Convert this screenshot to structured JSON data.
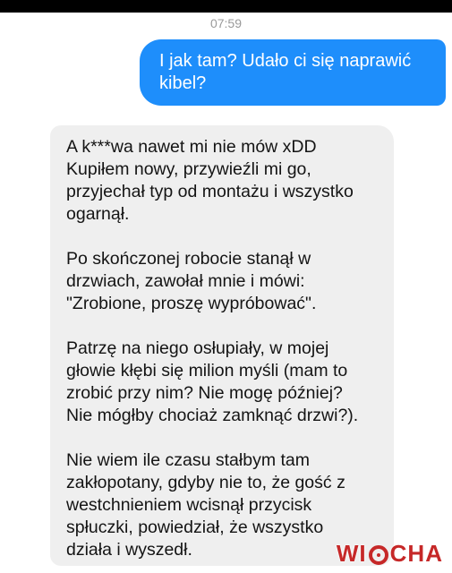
{
  "status": {
    "time": "07:59"
  },
  "messages": {
    "outgoing": {
      "lines": [
        "I jak tam? Udało ci się naprawić",
        "kibel?"
      ]
    },
    "incoming": {
      "paragraphs": [
        [
          "A k***wa nawet mi nie mów xDD",
          "Kupiłem nowy, przywieźli mi go,",
          "przyjechał typ od montażu i wszystko",
          "ogarnął."
        ],
        [
          "Po skończonej robocie stanął w",
          "drzwiach, zawołał mnie i mówi:",
          "\"Zrobione, proszę wypróbować\"."
        ],
        [
          "Patrzę na niego osłupiały, w mojej",
          "głowie kłębi się milion myśli (mam to",
          "zrobić przy nim? Nie mogę później?",
          "Nie mógłby chociaż zamknąć drzwi?)."
        ],
        [
          "Nie wiem ile czasu stałbym tam",
          "zakłopotany, gdyby nie to, że gość z",
          "westchnieniem wcisnął przycisk",
          "spłuczki, powiedział, że wszystko",
          "działa i wyszedł."
        ]
      ]
    }
  },
  "watermark": {
    "text_left": "WI",
    "text_right": "CHA"
  },
  "colors": {
    "outgoing_bubble": "#1e8efb",
    "incoming_bubble": "#efefef",
    "watermark": "#c62828"
  }
}
